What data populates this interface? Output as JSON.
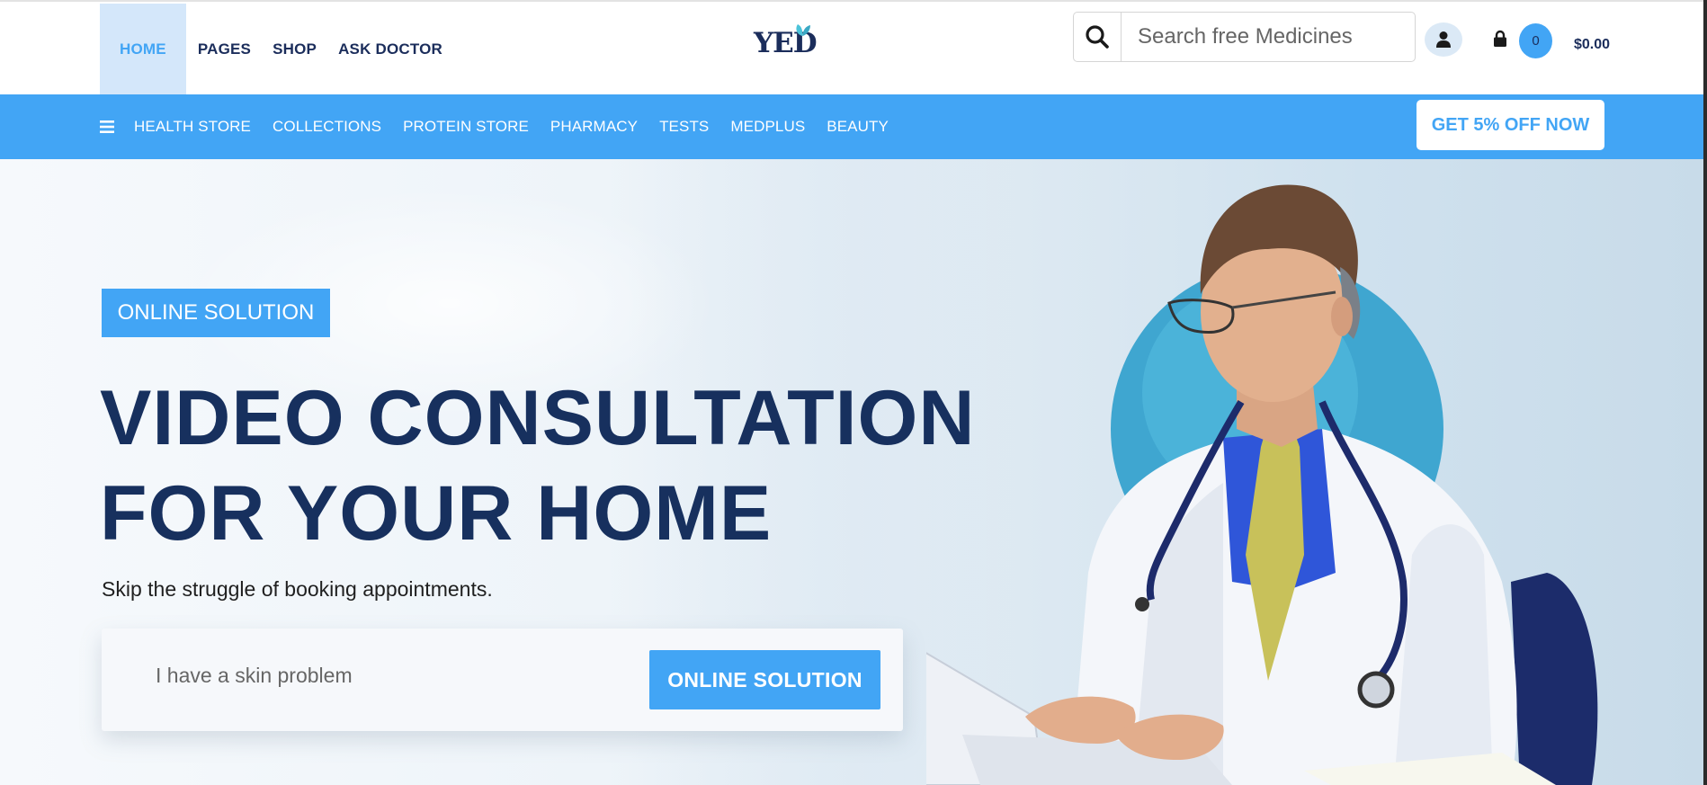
{
  "header": {
    "nav": [
      {
        "label": "HOME",
        "active": true
      },
      {
        "label": "PAGES",
        "active": false
      },
      {
        "label": "SHOP",
        "active": false
      },
      {
        "label": "ASK DOCTOR",
        "active": false
      }
    ],
    "logo": "YED",
    "search": {
      "placeholder": "Search free Medicines",
      "icon": "search-icon"
    },
    "cart": {
      "count": "0",
      "total": "$0.00"
    }
  },
  "category_bar": {
    "items": [
      "HEALTH STORE",
      "COLLECTIONS",
      "PROTEIN STORE",
      "PHARMACY",
      "TESTS",
      "MEDPLUS",
      "BEAUTY"
    ],
    "offer_button": "GET 5% OFF NOW"
  },
  "hero": {
    "tag": "ONLINE SOLUTION",
    "headline_line1": "VIDEO CONSULTATION",
    "headline_line2": "FOR YOUR HOME",
    "subtext": "Skip the struggle of booking appointments.",
    "form": {
      "placeholder": "I have a skin problem",
      "button": "ONLINE SOLUTION"
    }
  },
  "colors": {
    "accent": "#42a5f5",
    "navy": "#1b2d5b",
    "headline": "#17305e",
    "active_nav_bg": "#d4e7fa"
  }
}
